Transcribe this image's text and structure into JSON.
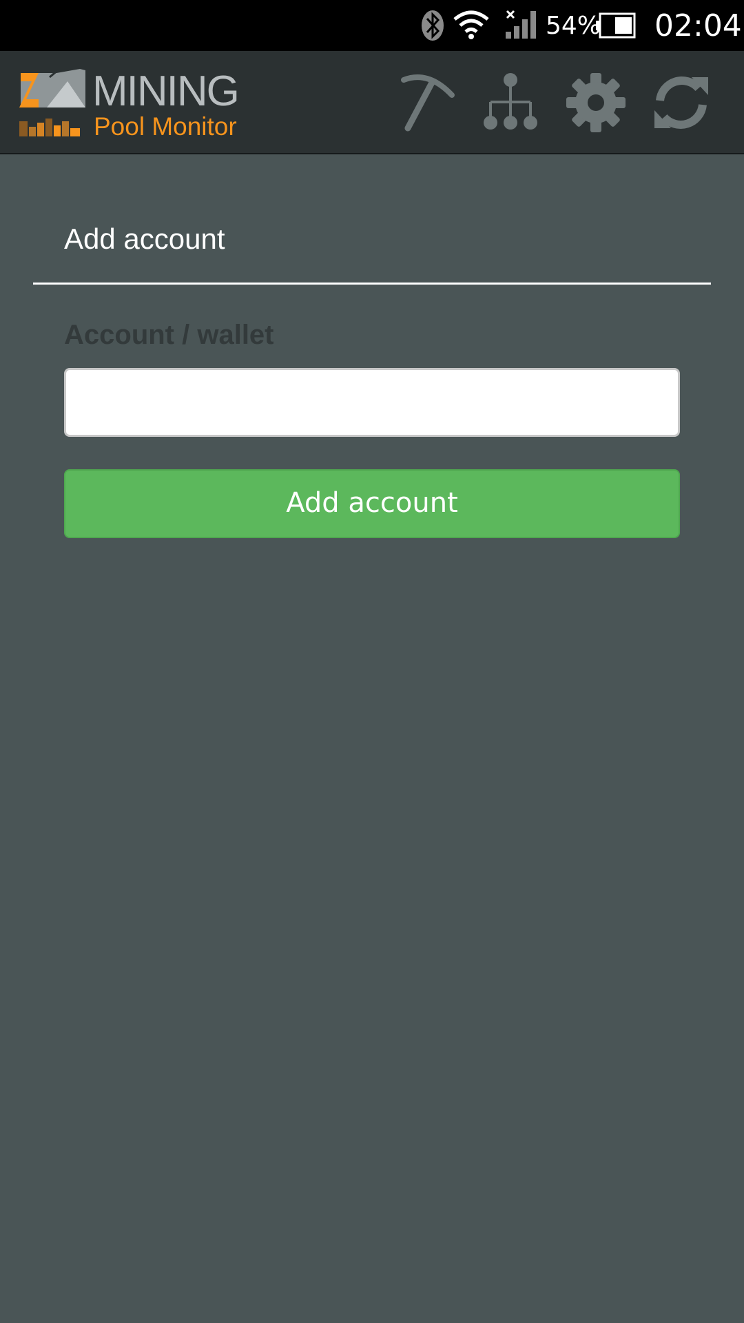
{
  "status_bar": {
    "battery_percent": "54%",
    "time": "02:04",
    "icons": [
      "bluetooth-icon",
      "wifi-icon",
      "signal-icon",
      "battery-icon"
    ]
  },
  "app": {
    "logo_title": "MINING",
    "logo_subtitle": "Pool Monitor",
    "brand_color": "#f7941d",
    "toolbar_icons": [
      "pickaxe-icon",
      "network-icon",
      "gear-icon",
      "refresh-icon"
    ]
  },
  "form": {
    "title": "Add account",
    "field_label": "Account / wallet",
    "field_value": "",
    "field_placeholder": "",
    "submit_label": "Add account",
    "submit_color": "#5cb85c"
  }
}
